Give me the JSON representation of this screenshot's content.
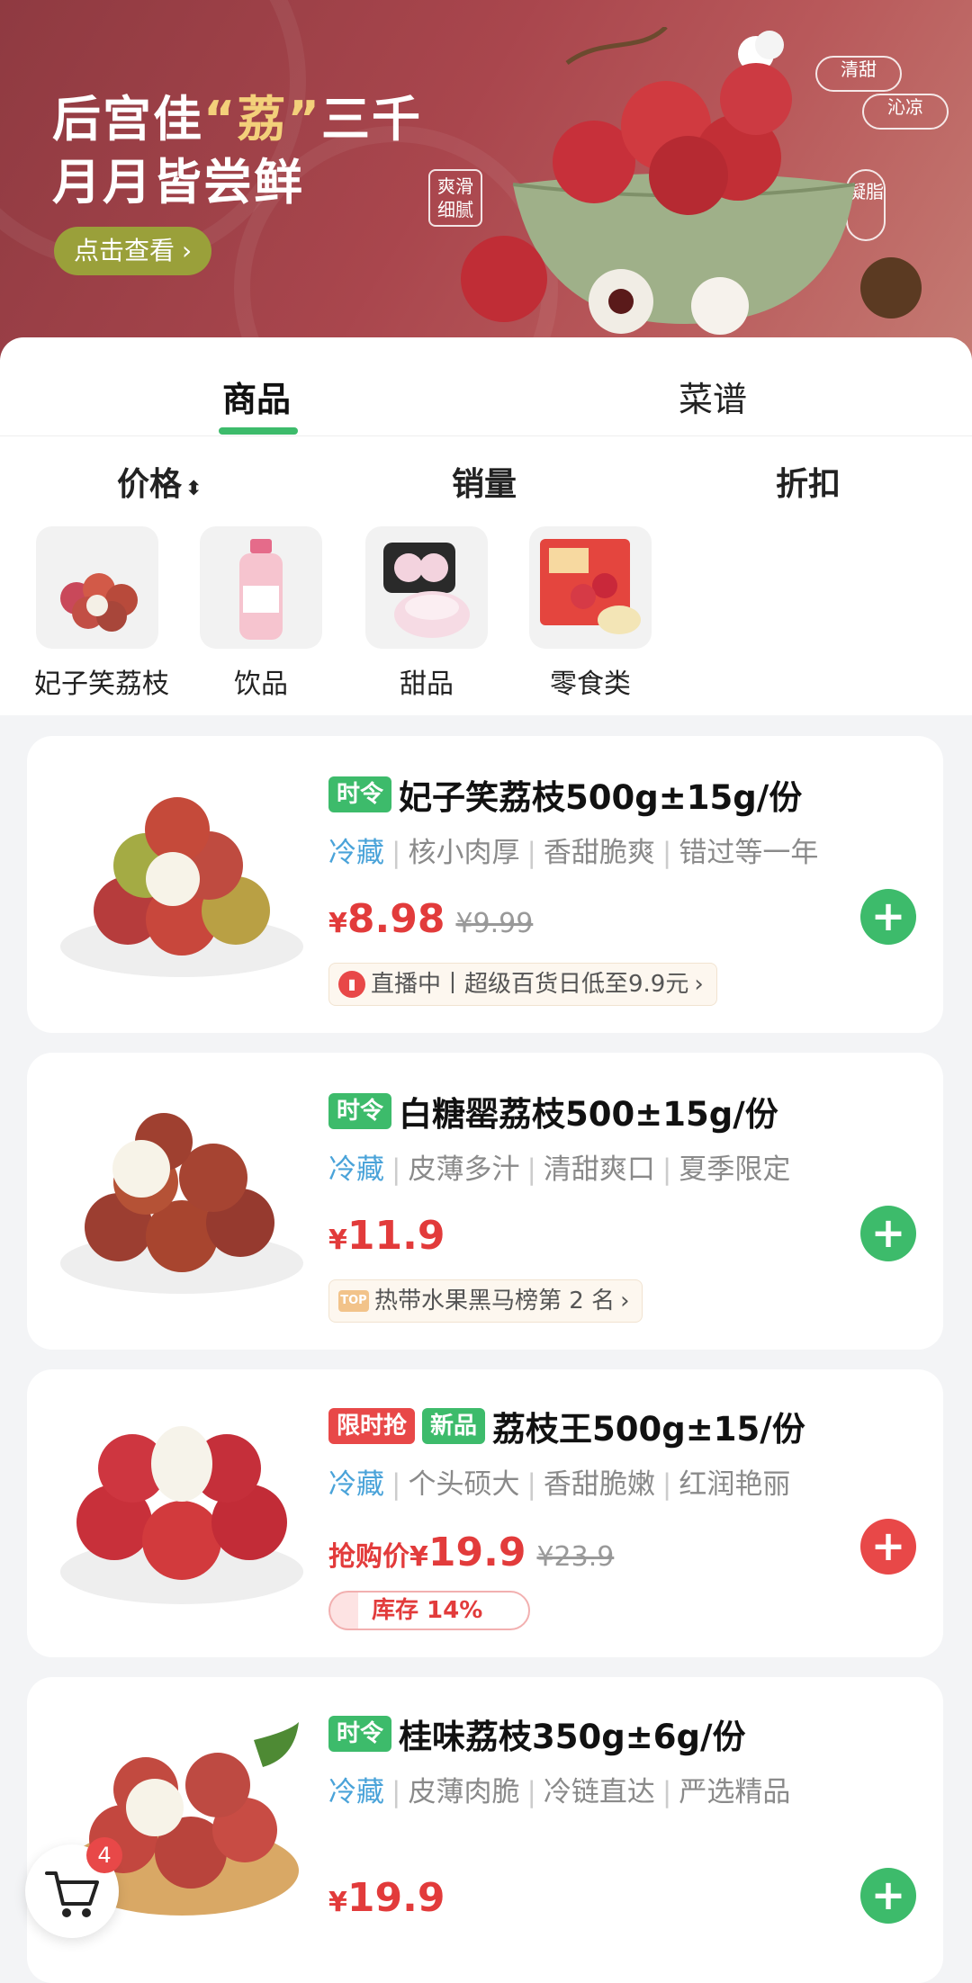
{
  "banner": {
    "title_line1_pre": "后宫佳",
    "title_line1_hl": "“荔”",
    "title_line1_post": "三千",
    "title_line2": "月月皆尝鲜",
    "cta": "点击查看",
    "seal1": "爽滑细腻",
    "seal2": "清甜",
    "seal3": "沁凉",
    "seal4": "凝脂"
  },
  "tabs": [
    {
      "label": "商品"
    },
    {
      "label": "菜谱"
    }
  ],
  "sort": {
    "price": "价格",
    "sales": "销量",
    "discount": "折扣"
  },
  "categories": [
    {
      "label": "妃子笑荔枝"
    },
    {
      "label": "饮品"
    },
    {
      "label": "甜品"
    },
    {
      "label": "零食类"
    }
  ],
  "products": [
    {
      "tags": [
        "时令"
      ],
      "name": "妃子笑荔枝500g±15g/份",
      "cold": "冷藏",
      "attrs": [
        "核小肉厚",
        "香甜脆爽",
        "错过等一年"
      ],
      "price_yen": "¥",
      "price": "8.98",
      "old_price": "¥9.99",
      "promo": "直播中丨超级百货日低至9.9元",
      "promo_icon": "live-icon"
    },
    {
      "tags": [
        "时令"
      ],
      "name": "白糖罂荔枝500±15g/份",
      "cold": "冷藏",
      "attrs": [
        "皮薄多汁",
        "清甜爽口",
        "夏季限定"
      ],
      "price_yen": "¥",
      "price": "11.9",
      "promo": "热带水果黑马榜第 2 名",
      "promo_icon": "top-icon"
    },
    {
      "tags": [
        "限时抢",
        "新品"
      ],
      "name": "荔枝王500g±15/份",
      "cold": "冷藏",
      "attrs": [
        "个头硕大",
        "香甜脆嫩",
        "红润艳丽"
      ],
      "price_prefix": "抢购价",
      "price_yen": "¥",
      "price": "19.9",
      "old_price": "¥23.9",
      "stock": "库存 14%",
      "stock_level": 0.14
    },
    {
      "tags": [
        "时令"
      ],
      "name": "桂味荔枝350g±6g/份",
      "cold": "冷藏",
      "attrs": [
        "皮薄肉脆",
        "冷链直达",
        "严选精品"
      ],
      "price_yen": "¥",
      "price": "19.9"
    }
  ],
  "cart": {
    "count": "4"
  },
  "colors": {
    "accent_green": "#3dbb6b",
    "accent_red": "#e84848",
    "price_red": "#e23b3b",
    "cold_blue": "#4aa3d9"
  }
}
